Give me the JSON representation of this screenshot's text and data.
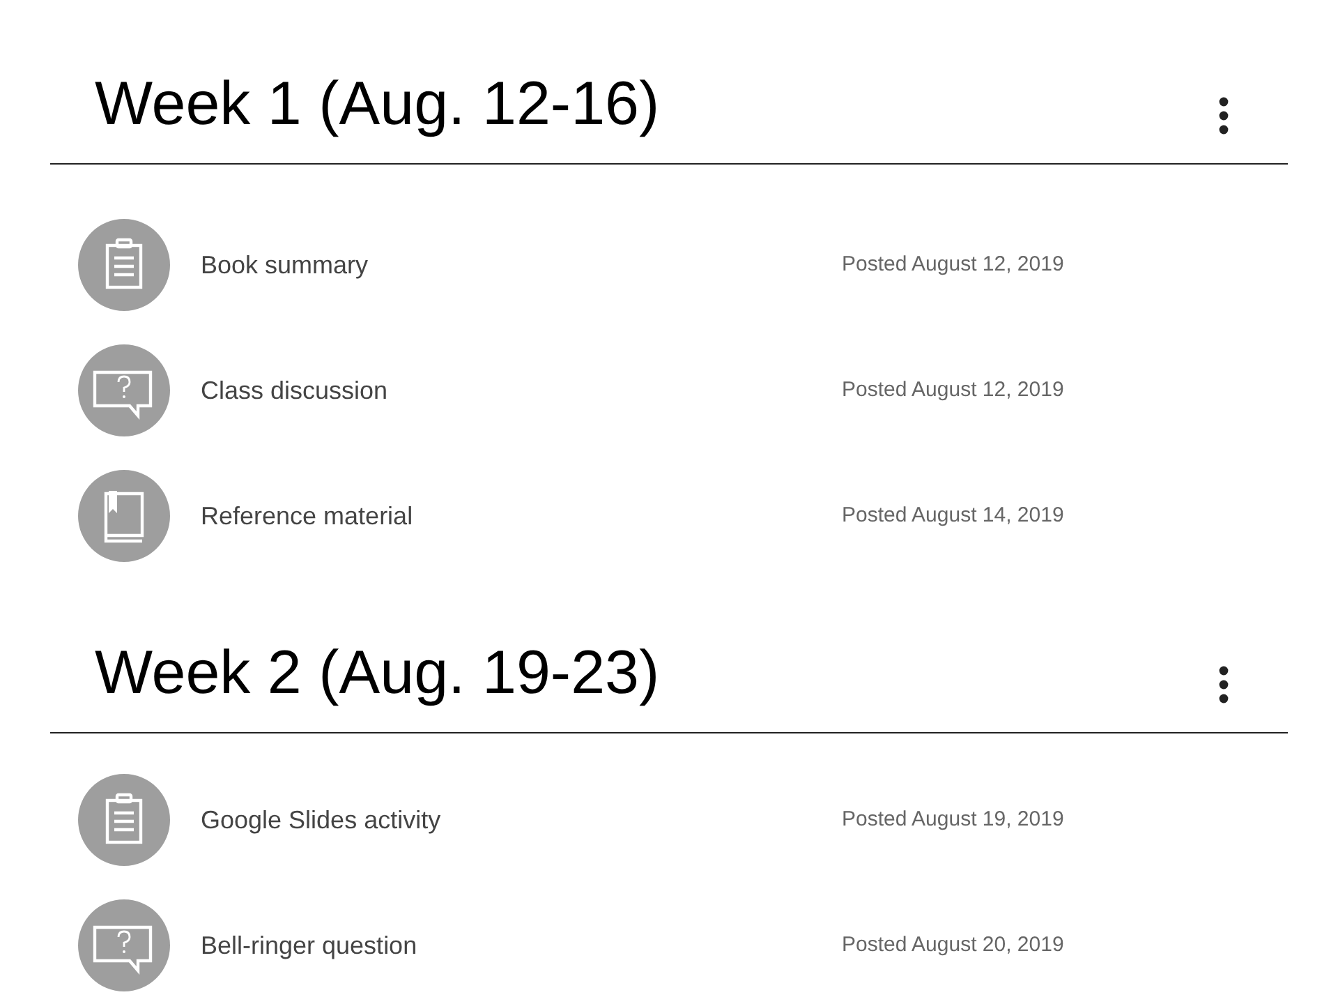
{
  "sections": [
    {
      "title": "Week 1 (Aug. 12-16)",
      "items": [
        {
          "kind": "assignment",
          "title": "Book summary",
          "posted": "Posted August 12, 2019"
        },
        {
          "kind": "question",
          "title": "Class discussion",
          "posted": "Posted August 12, 2019"
        },
        {
          "kind": "material",
          "title": "Reference material",
          "posted": "Posted August 14, 2019"
        }
      ]
    },
    {
      "title": "Week 2 (Aug. 19-23)",
      "items": [
        {
          "kind": "assignment",
          "title": "Google Slides activity",
          "posted": "Posted August 19, 2019"
        },
        {
          "kind": "question",
          "title": "Bell-ringer question",
          "posted": "Posted August 20, 2019"
        }
      ]
    }
  ]
}
